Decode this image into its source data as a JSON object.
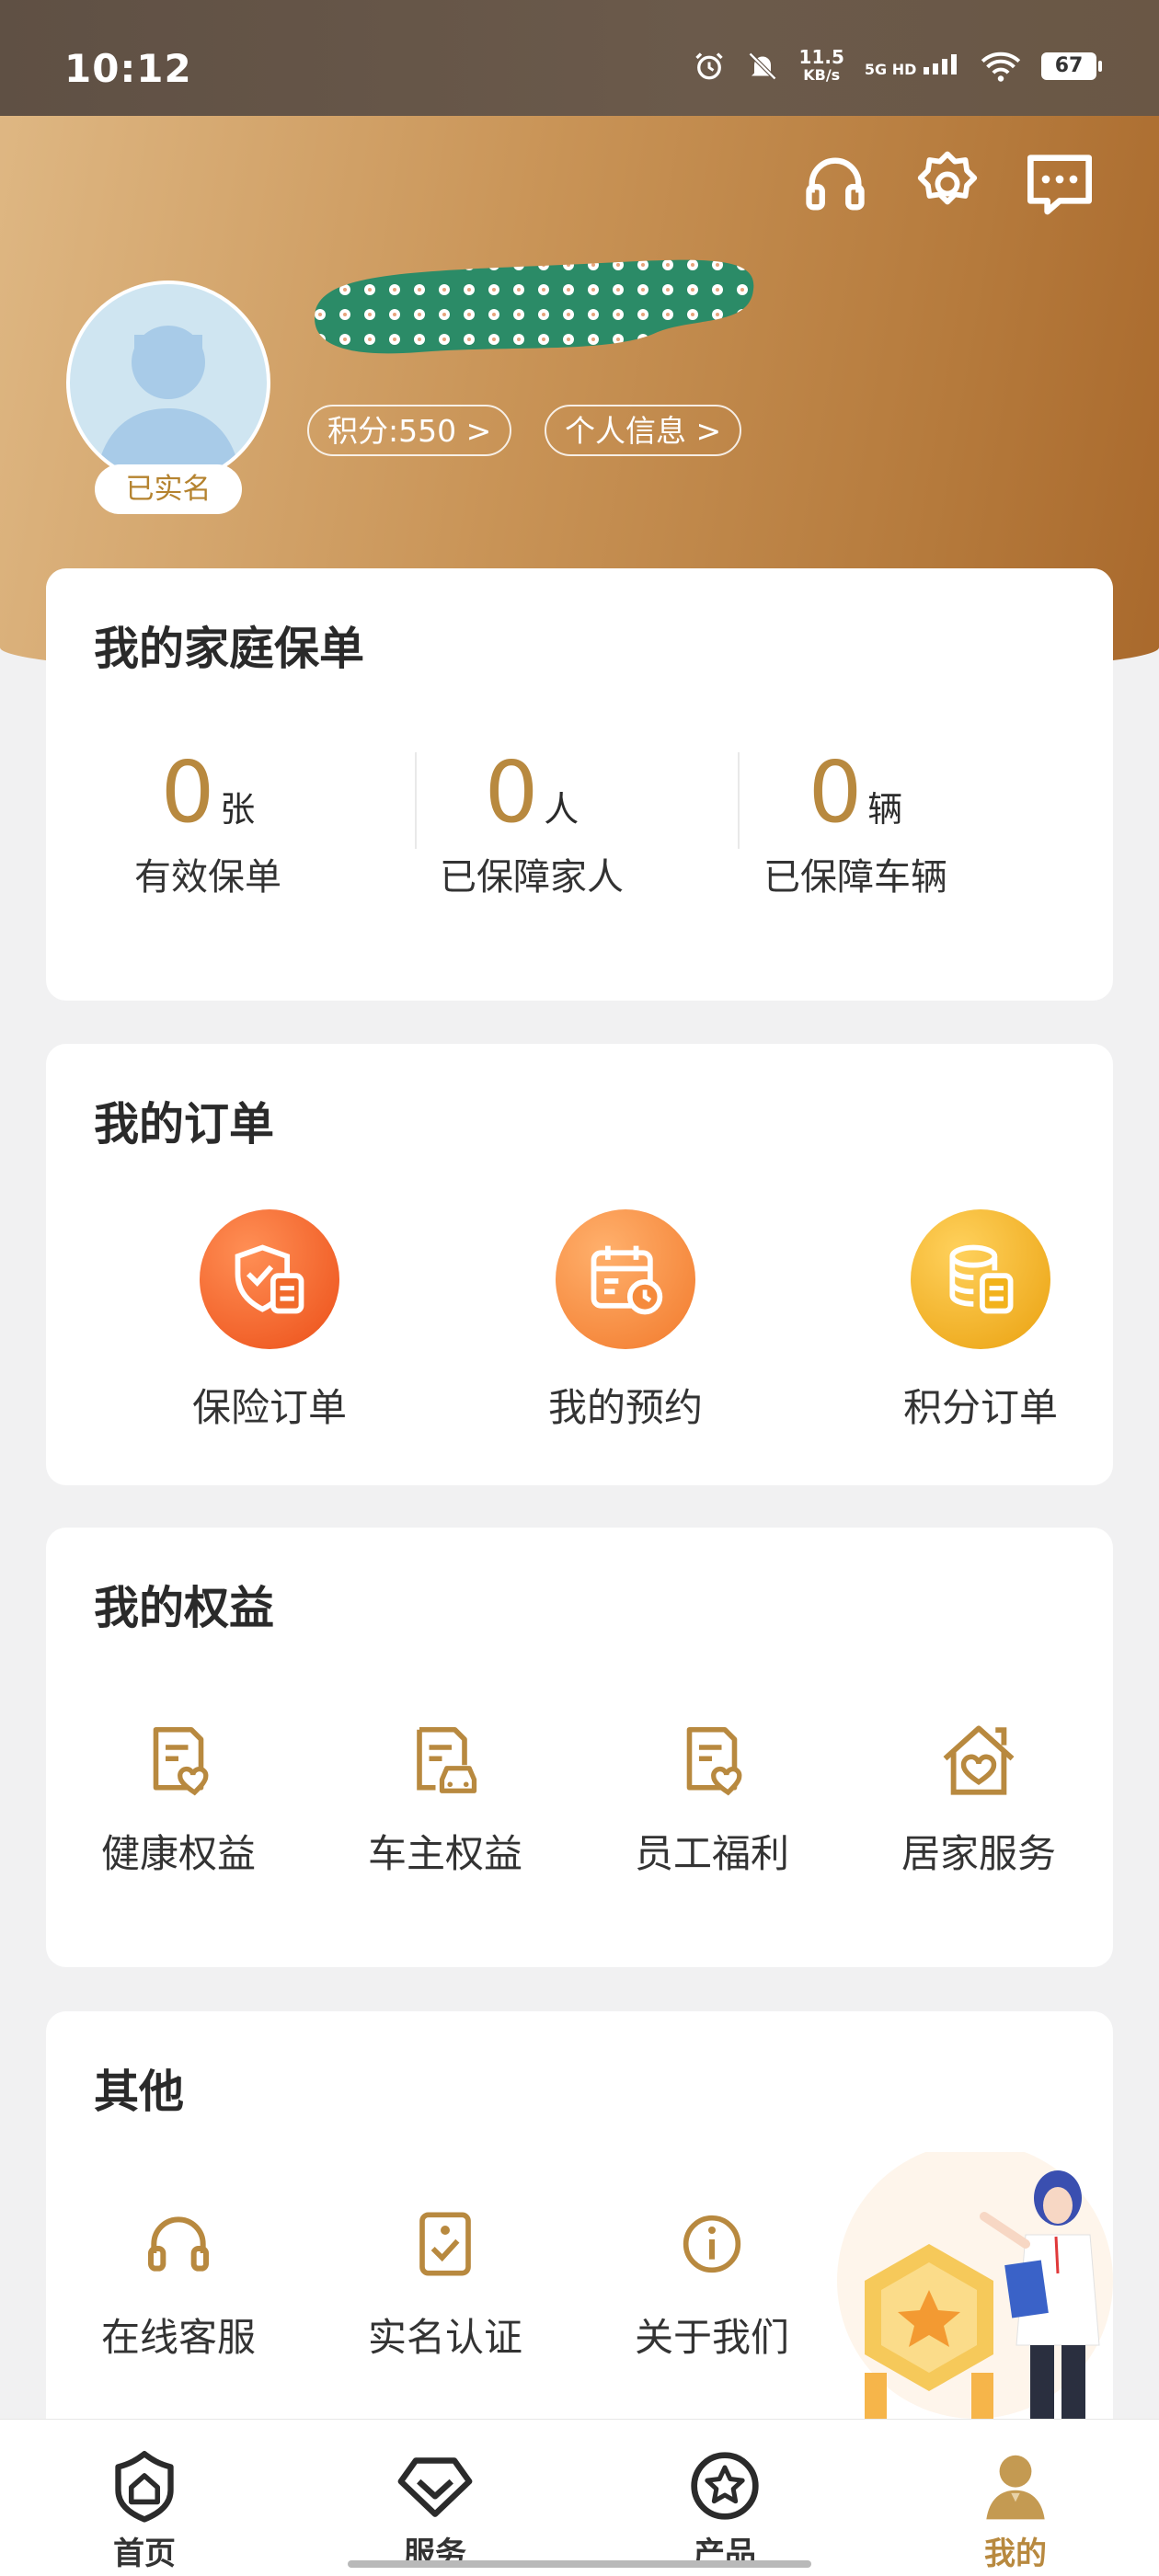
{
  "status_bar": {
    "time": "10:12",
    "net_speed": "11.5",
    "net_speed_unit": "KB/s",
    "network": "5G HD",
    "battery": "67"
  },
  "profile": {
    "verified_badge": "已实名",
    "points_pill": "积分:550 >",
    "info_pill": "个人信息 >"
  },
  "policies": {
    "title": "我的家庭保单",
    "stats": [
      {
        "value": "0",
        "unit": "张",
        "label": "有效保单"
      },
      {
        "value": "0",
        "unit": "人",
        "label": "已保障家人"
      },
      {
        "value": "0",
        "unit": "辆",
        "label": "已保障车辆"
      }
    ]
  },
  "orders": {
    "title": "我的订单",
    "items": [
      {
        "label": "保险订单",
        "icon": "shield-document-icon",
        "color": "#ee5a22"
      },
      {
        "label": "我的预约",
        "icon": "calendar-clock-icon",
        "color": "#f58a3c"
      },
      {
        "label": "积分订单",
        "icon": "coins-document-icon",
        "color": "#f2b21b"
      }
    ]
  },
  "benefits": {
    "title": "我的权益",
    "items": [
      {
        "label": "健康权益",
        "icon": "document-heart-icon"
      },
      {
        "label": "车主权益",
        "icon": "document-car-icon"
      },
      {
        "label": "员工福利",
        "icon": "document-heart-icon"
      },
      {
        "label": "居家服务",
        "icon": "house-heart-icon"
      }
    ]
  },
  "other": {
    "title": "其他",
    "items": [
      {
        "label": "在线客服",
        "icon": "headset-icon"
      },
      {
        "label": "实名认证",
        "icon": "id-card-check-icon"
      },
      {
        "label": "关于我们",
        "icon": "info-icon"
      }
    ]
  },
  "bottom_nav": [
    {
      "label": "首页",
      "icon": "shield-home-icon",
      "active": false
    },
    {
      "label": "服务",
      "icon": "diamond-service-icon",
      "active": false
    },
    {
      "label": "产品",
      "icon": "star-circle-icon",
      "active": false
    },
    {
      "label": "我的",
      "icon": "user-icon",
      "active": true
    }
  ],
  "colors": {
    "accent": "#b8893f",
    "header_start": "#dfb884",
    "header_end": "#a9692c"
  }
}
